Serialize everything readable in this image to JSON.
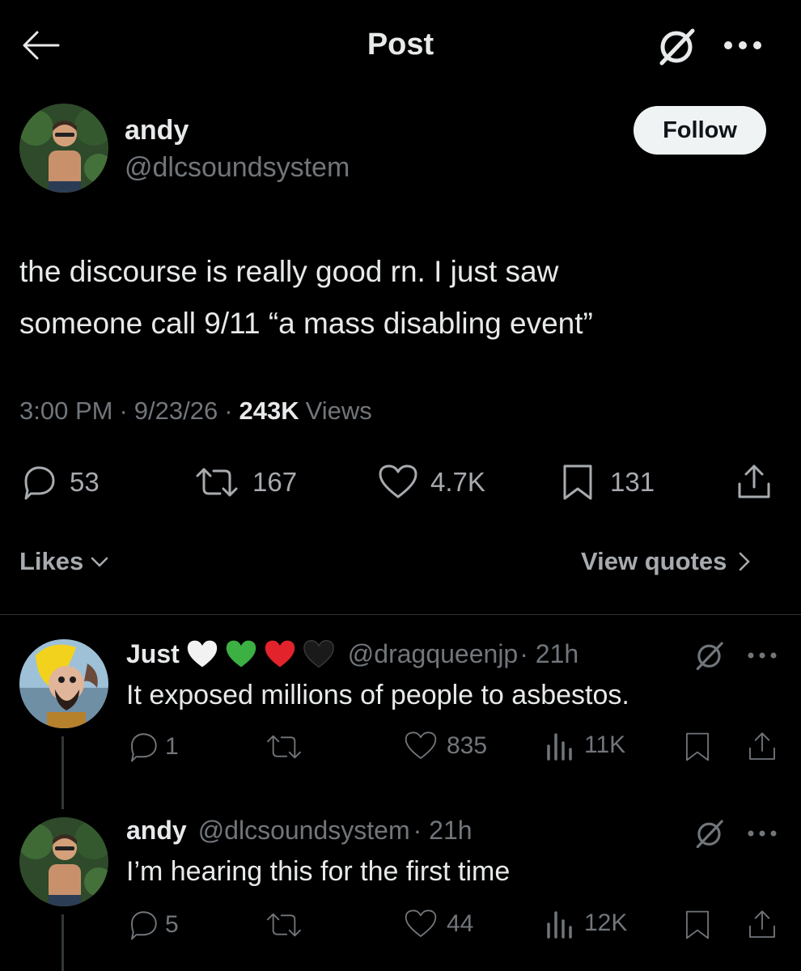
{
  "header": {
    "title": "Post",
    "back_icon": "arrow-left-icon",
    "grok_icon": "grok-icon",
    "more_icon": "more-horizontal-icon"
  },
  "post": {
    "author": {
      "name": "andy",
      "handle": "@dlcsoundsystem"
    },
    "follow_label": "Follow",
    "text_line1": "the discourse is really good rn. I just saw",
    "text_line2": "someone call 9/11 “a mass disabling event”",
    "time": "3:00 PM",
    "dot1": "·",
    "date": "9/23/26",
    "dot2": "·",
    "views_count": "243K",
    "views_label": "Views",
    "actions": {
      "replies": "53",
      "reposts": "167",
      "likes": "4.7K",
      "bookmarks": "131"
    },
    "likes_label": "Likes",
    "view_quotes_label": "View quotes"
  },
  "replies": [
    {
      "name": "Just",
      "handle": "@dragqueenjp",
      "age": "· 21h",
      "text": "It exposed millions of people to asbestos.",
      "replies": "1",
      "reposts": "",
      "likes": "835",
      "views": "11K"
    },
    {
      "name": "andy",
      "handle": "@dlcsoundsystem",
      "age": "· 21h",
      "text": "I’m hearing this for the first time",
      "replies": "5",
      "reposts": "",
      "likes": "44",
      "views": "12K"
    }
  ],
  "colors": {
    "background": "#000000",
    "text": "#e7e9ea",
    "muted": "#71767b",
    "divider": "#2f3336"
  }
}
